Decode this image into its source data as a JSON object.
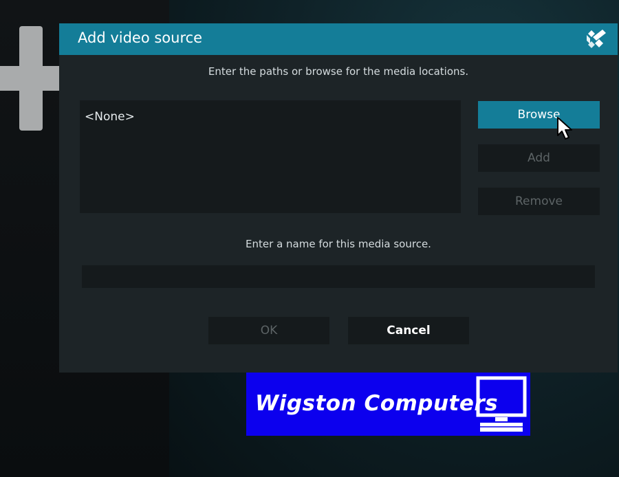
{
  "dialog": {
    "title": "Add video source",
    "paths_instruction": "Enter the paths or browse for the media locations.",
    "sources": [
      "<None>"
    ],
    "buttons": {
      "browse": "Browse",
      "add": "Add",
      "remove": "Remove",
      "ok": "OK",
      "cancel": "Cancel"
    },
    "name_instruction": "Enter a name for this media source.",
    "name_value": ""
  },
  "watermark": {
    "text": "Wigston Computers"
  },
  "colors": {
    "header": "#147d98",
    "dialog_bg": "#1d2427",
    "field_bg": "#151a1c",
    "watermark_bg": "#0c00ee"
  },
  "icons": [
    "plus-icon",
    "kodi-logo-icon",
    "mouse-pointer-icon",
    "monitor-icon"
  ]
}
